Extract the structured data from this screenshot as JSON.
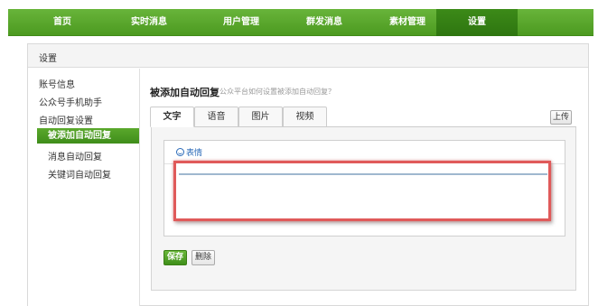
{
  "nav": {
    "items": [
      {
        "label": "首页"
      },
      {
        "label": "实时消息"
      },
      {
        "label": "用户管理"
      },
      {
        "label": "群发消息"
      },
      {
        "label": "素材管理"
      },
      {
        "label": "设置"
      }
    ],
    "active": "设置"
  },
  "panel": {
    "title": "设置"
  },
  "sidebar": {
    "items": [
      {
        "label": "账号信息"
      },
      {
        "label": "公众号手机助手"
      },
      {
        "label": "自动回复设置"
      },
      {
        "label": "被添加自动回复"
      },
      {
        "label": "消息自动回复"
      },
      {
        "label": "关键词自动回复"
      }
    ],
    "active": "被添加自动回复"
  },
  "main": {
    "title": "被添加自动回复",
    "help_link": "公众平台如何设置被添加自动回复？",
    "tabs": [
      {
        "label": "文字"
      },
      {
        "label": "语音"
      },
      {
        "label": "图片"
      },
      {
        "label": "视频"
      }
    ],
    "active_tab": "文字",
    "upload_label": "上传",
    "emoji_label": "表情",
    "save_label": "保存",
    "delete_label": "删除"
  },
  "colors": {
    "brand_green": "#4c9a20",
    "nav_active": "#2e7510",
    "highlight_red": "#e05a5a"
  }
}
